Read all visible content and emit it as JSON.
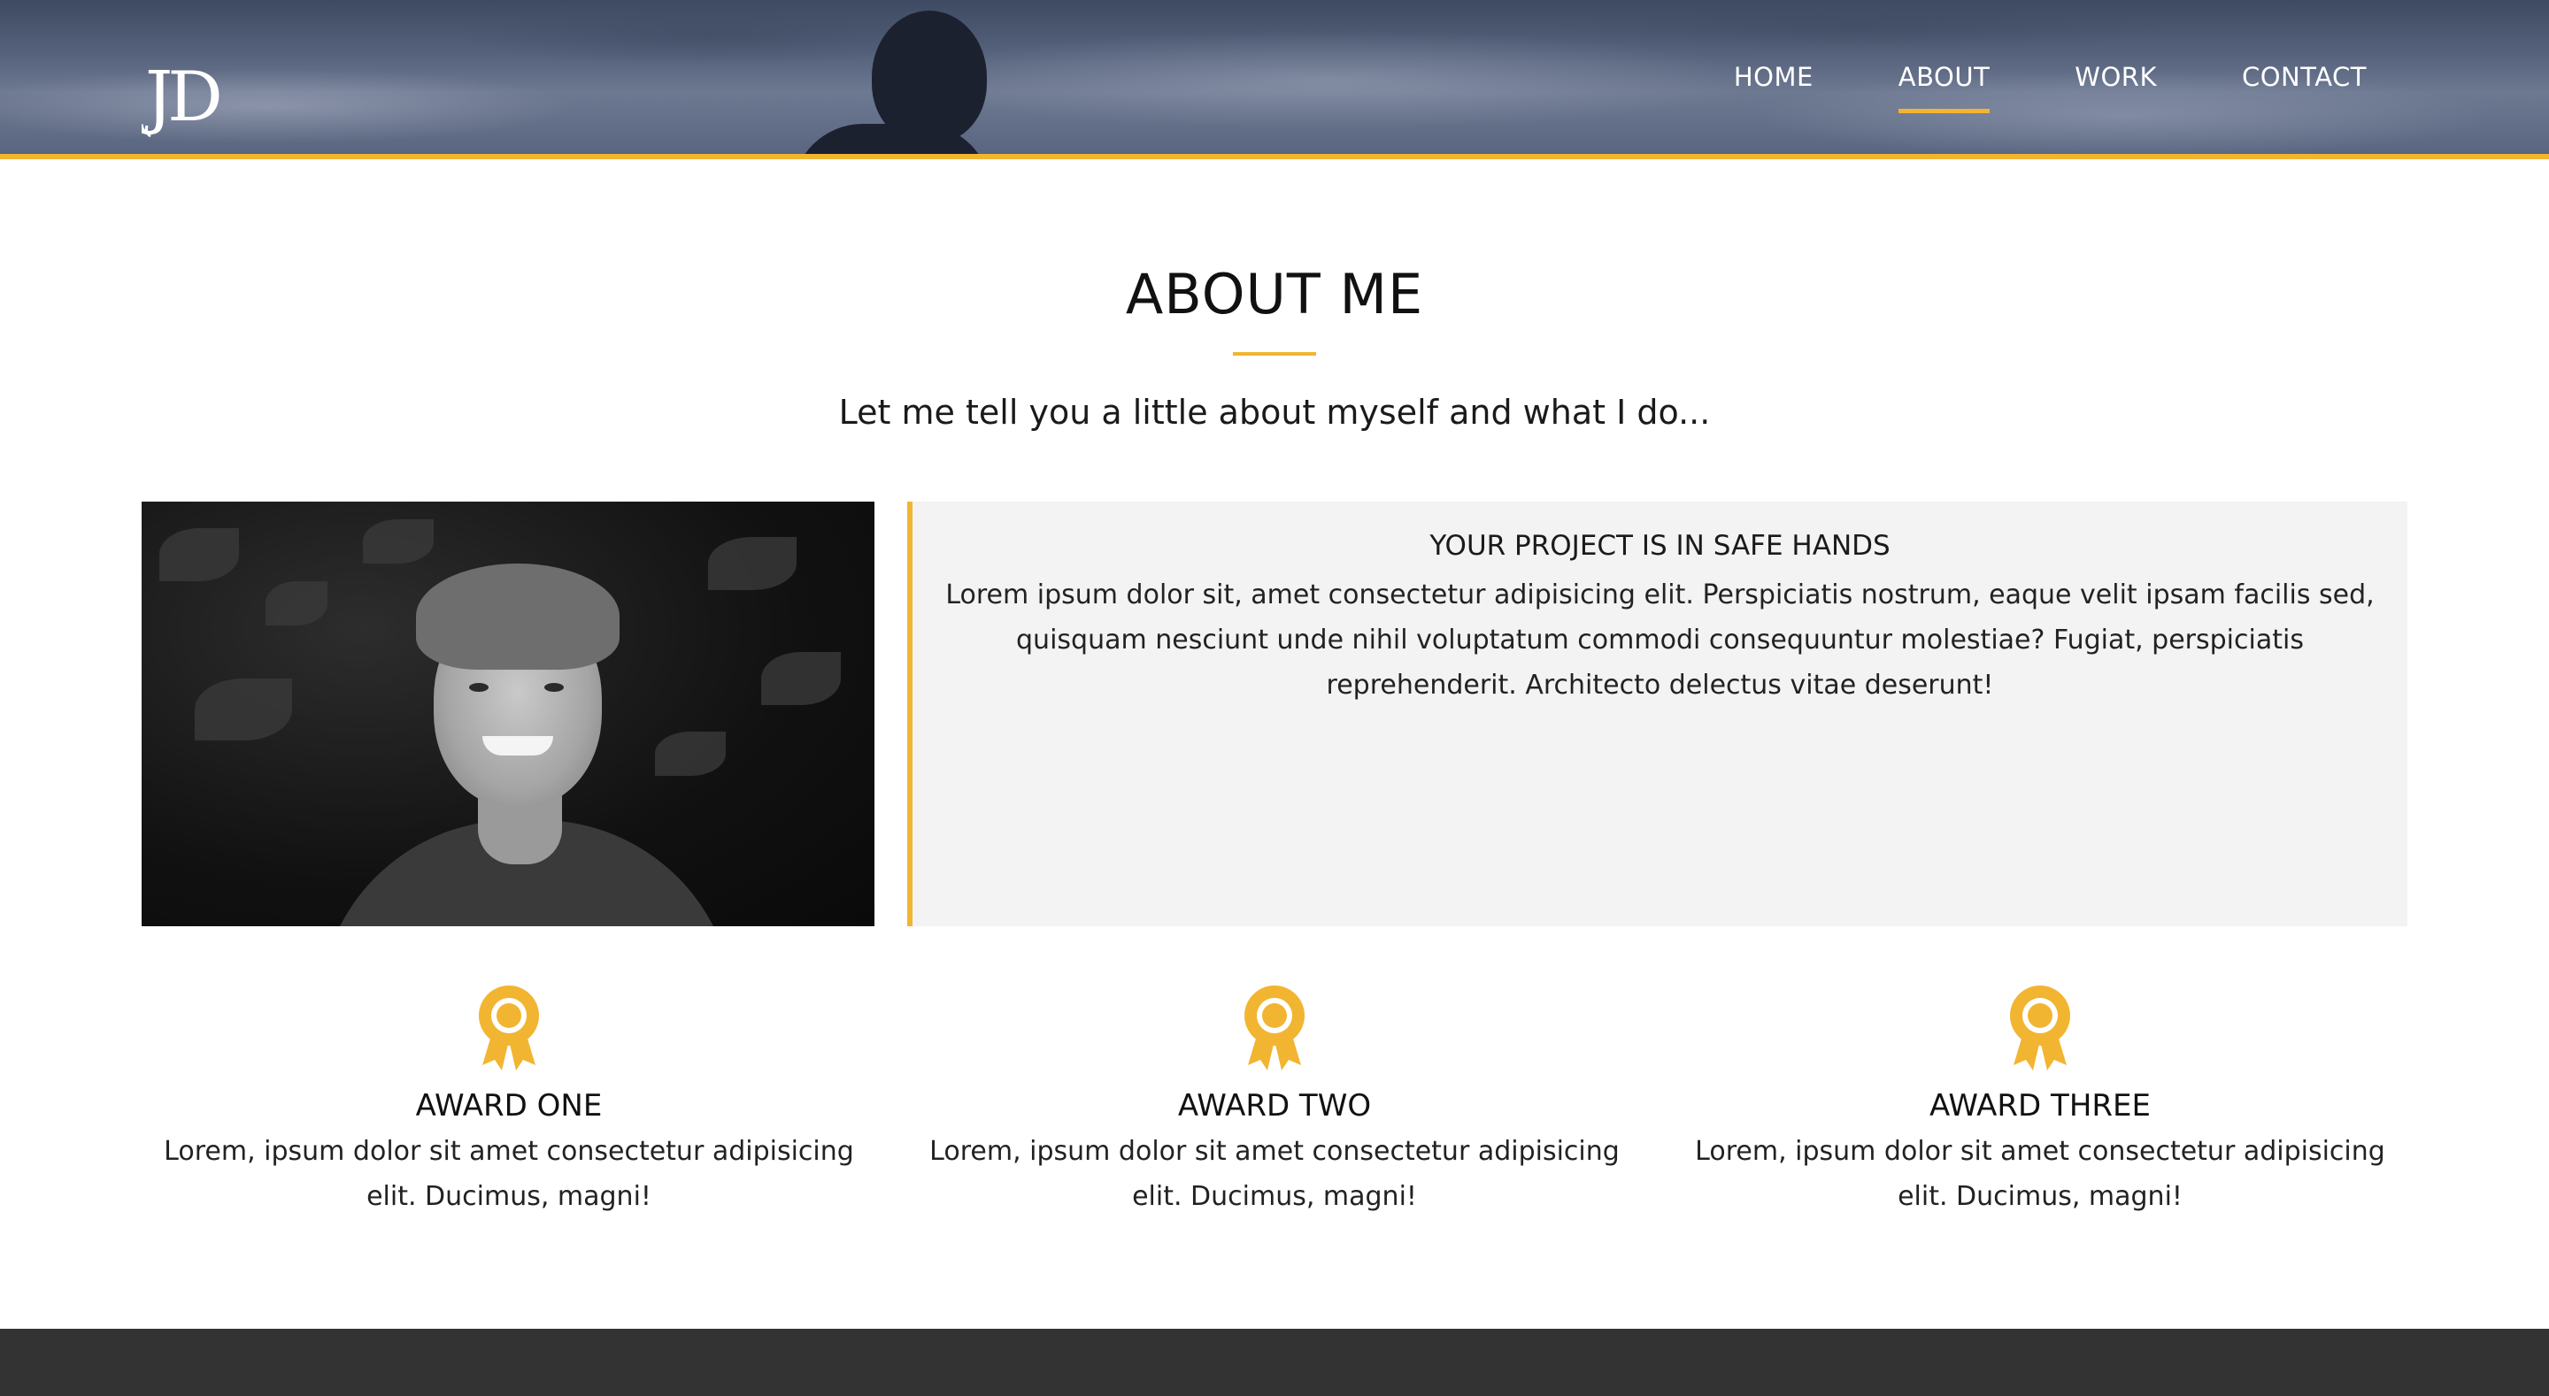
{
  "brand": {
    "logo_text": "JD",
    "accent_color": "#f2b531"
  },
  "nav": {
    "items": [
      {
        "label": "HOME",
        "active": false
      },
      {
        "label": "ABOUT",
        "active": true
      },
      {
        "label": "WORK",
        "active": false
      },
      {
        "label": "CONTACT",
        "active": false
      }
    ]
  },
  "about": {
    "title": "ABOUT ME",
    "tagline": "Let me tell you a little about myself and what I do..."
  },
  "info": {
    "title": "YOUR PROJECT IS IN SAFE HANDS",
    "text": "Lorem ipsum dolor sit, amet consectetur adipisicing elit. Perspiciatis nostrum, eaque velit ipsam facilis sed, quisquam nesciunt unde nihil voluptatum commodi consequuntur molestiae? Fugiat, perspiciatis reprehenderit. Architecto delectus vitae deserunt!"
  },
  "awards": [
    {
      "icon": "award-ribbon-icon",
      "title": "AWARD ONE",
      "text": "Lorem, ipsum dolor sit amet consectetur adipisicing elit. Ducimus, magni!"
    },
    {
      "icon": "award-ribbon-icon",
      "title": "AWARD TWO",
      "text": "Lorem, ipsum dolor sit amet consectetur adipisicing elit. Ducimus, magni!"
    },
    {
      "icon": "award-ribbon-icon",
      "title": "AWARD THREE",
      "text": "Lorem, ipsum dolor sit amet consectetur adipisicing elit. Ducimus, magni!"
    }
  ],
  "footer": {
    "background": "#333333"
  }
}
